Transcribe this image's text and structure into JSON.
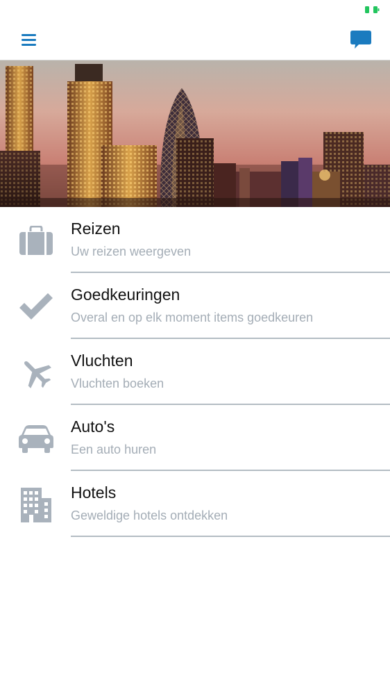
{
  "colors": {
    "accent": "#1b7bbf",
    "icon_gray": "#a9b2bc",
    "title_text": "#111111",
    "subtitle_text": "#a4adb6",
    "divider": "#b3bcc3",
    "battery": "#22c55e"
  },
  "status_bar": {
    "battery_icon": "battery-charging-icon"
  },
  "nav": {
    "menu_icon": "hamburger-menu-icon",
    "chat_icon": "chat-bubble-icon"
  },
  "hero": {
    "image": "city-skyline-at-sunset"
  },
  "menu": {
    "items": [
      {
        "icon": "suitcase-icon",
        "title": "Reizen",
        "subtitle": "Uw reizen weergeven"
      },
      {
        "icon": "checkmark-icon",
        "title": "Goedkeuringen",
        "subtitle": "Overal en op elk moment items goedkeuren"
      },
      {
        "icon": "airplane-icon",
        "title": "Vluchten",
        "subtitle": "Vluchten boeken"
      },
      {
        "icon": "car-icon",
        "title": "Auto's",
        "subtitle": "Een auto huren"
      },
      {
        "icon": "building-icon",
        "title": "Hotels",
        "subtitle": "Geweldige hotels ontdekken"
      }
    ]
  }
}
